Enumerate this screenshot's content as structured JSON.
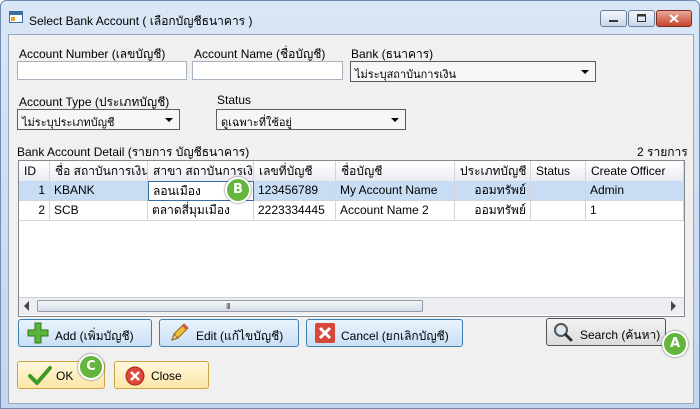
{
  "window": {
    "title": "Select Bank Account ( เลือกบัญชีธนาคาร )"
  },
  "form": {
    "account_number_label": "Account Number (เลขบัญชี)",
    "account_number_value": "",
    "account_name_label": "Account Name (ชื่อบัญชี)",
    "account_name_value": "",
    "bank_label": "Bank (ธนาคาร)",
    "bank_value": "ไม่ระบุสถาบันการเงิน",
    "account_type_label": "Account Type (ประเภทบัญชี)",
    "account_type_value": "ไม่ระบุประเภทบัญชี",
    "status_label": "Status",
    "status_value": "ดูเฉพาะที่ใช้อยู่"
  },
  "grid": {
    "title": "Bank Account Detail (รายการ บัญชีธนาคาร)",
    "count": "2 รายการ",
    "columns": [
      "ID",
      "ชื่อ สถาบันการเงิน",
      "สาขา สถาบันการเงิน",
      "เลขที่บัญชี",
      "ชื่อบัญชี",
      "ประเภทบัญชี",
      "Status",
      "Create Officer"
    ],
    "rows": [
      {
        "id": "1",
        "bank": "KBANK",
        "branch": "ลอนเมือง",
        "number": "123456789",
        "name": "My Account Name",
        "type": "ออมทรัพย์",
        "status": "",
        "officer": "Admin"
      },
      {
        "id": "2",
        "bank": "SCB",
        "branch": "ตลาดสี่มุมเมือง",
        "number": "2223334445",
        "name": "Account Name 2",
        "type": "ออมทรัพย์",
        "status": "",
        "officer": "1"
      }
    ],
    "scroll_grip": "III"
  },
  "buttons": {
    "add": "Add (เพิ่มบัญชี)",
    "edit": "Edit (แก้ไขบัญชี)",
    "cancel": "Cancel (ยกเลิกบัญชี)",
    "search": "Search (ค้นหา)",
    "ok": "OK",
    "close": "Close"
  },
  "callouts": {
    "a": "A",
    "b": "B",
    "c": "C"
  },
  "colors": {
    "selection": "#c8dcf3",
    "callout": "#64b53c",
    "close_button": "#c8442e"
  }
}
